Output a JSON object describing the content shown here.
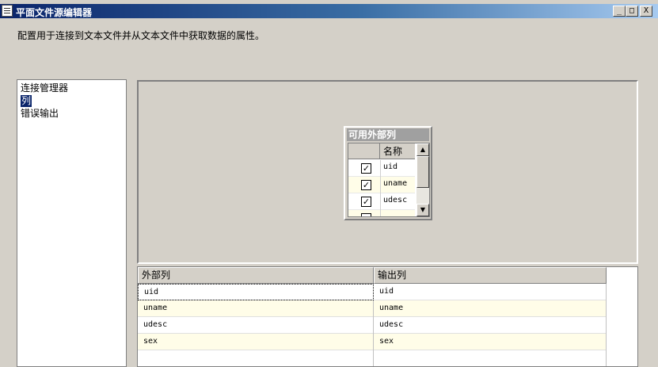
{
  "window": {
    "title": "平面文件源编辑器",
    "minimize": "_",
    "maximize": "□",
    "close": "X"
  },
  "description": "配置用于连接到文本文件并从文本文件中获取数据的属性。",
  "nav": {
    "items": [
      {
        "label": "连接管理器",
        "selected": false
      },
      {
        "label": "列",
        "selected": true
      },
      {
        "label": "错误输出",
        "selected": false
      }
    ]
  },
  "available_columns": {
    "title": "可用外部列",
    "header": "名称",
    "rows": [
      {
        "name": "uid",
        "checked": true
      },
      {
        "name": "uname",
        "checked": true
      },
      {
        "name": "udesc",
        "checked": true
      }
    ],
    "check_mark": "✓"
  },
  "mapping": {
    "headers": {
      "external": "外部列",
      "output": "输出列"
    },
    "rows": [
      {
        "external": "uid",
        "output": "uid"
      },
      {
        "external": "uname",
        "output": "uname"
      },
      {
        "external": "udesc",
        "output": "udesc"
      },
      {
        "external": "sex",
        "output": "sex"
      }
    ]
  },
  "icons": {
    "scroll_up": "▲",
    "scroll_down": "▼"
  },
  "colors": {
    "title_bar_start": "#0a246a",
    "selection": "#0a246a",
    "dialog_bg": "#d4d0c8",
    "alt_row": "#fffde8"
  }
}
